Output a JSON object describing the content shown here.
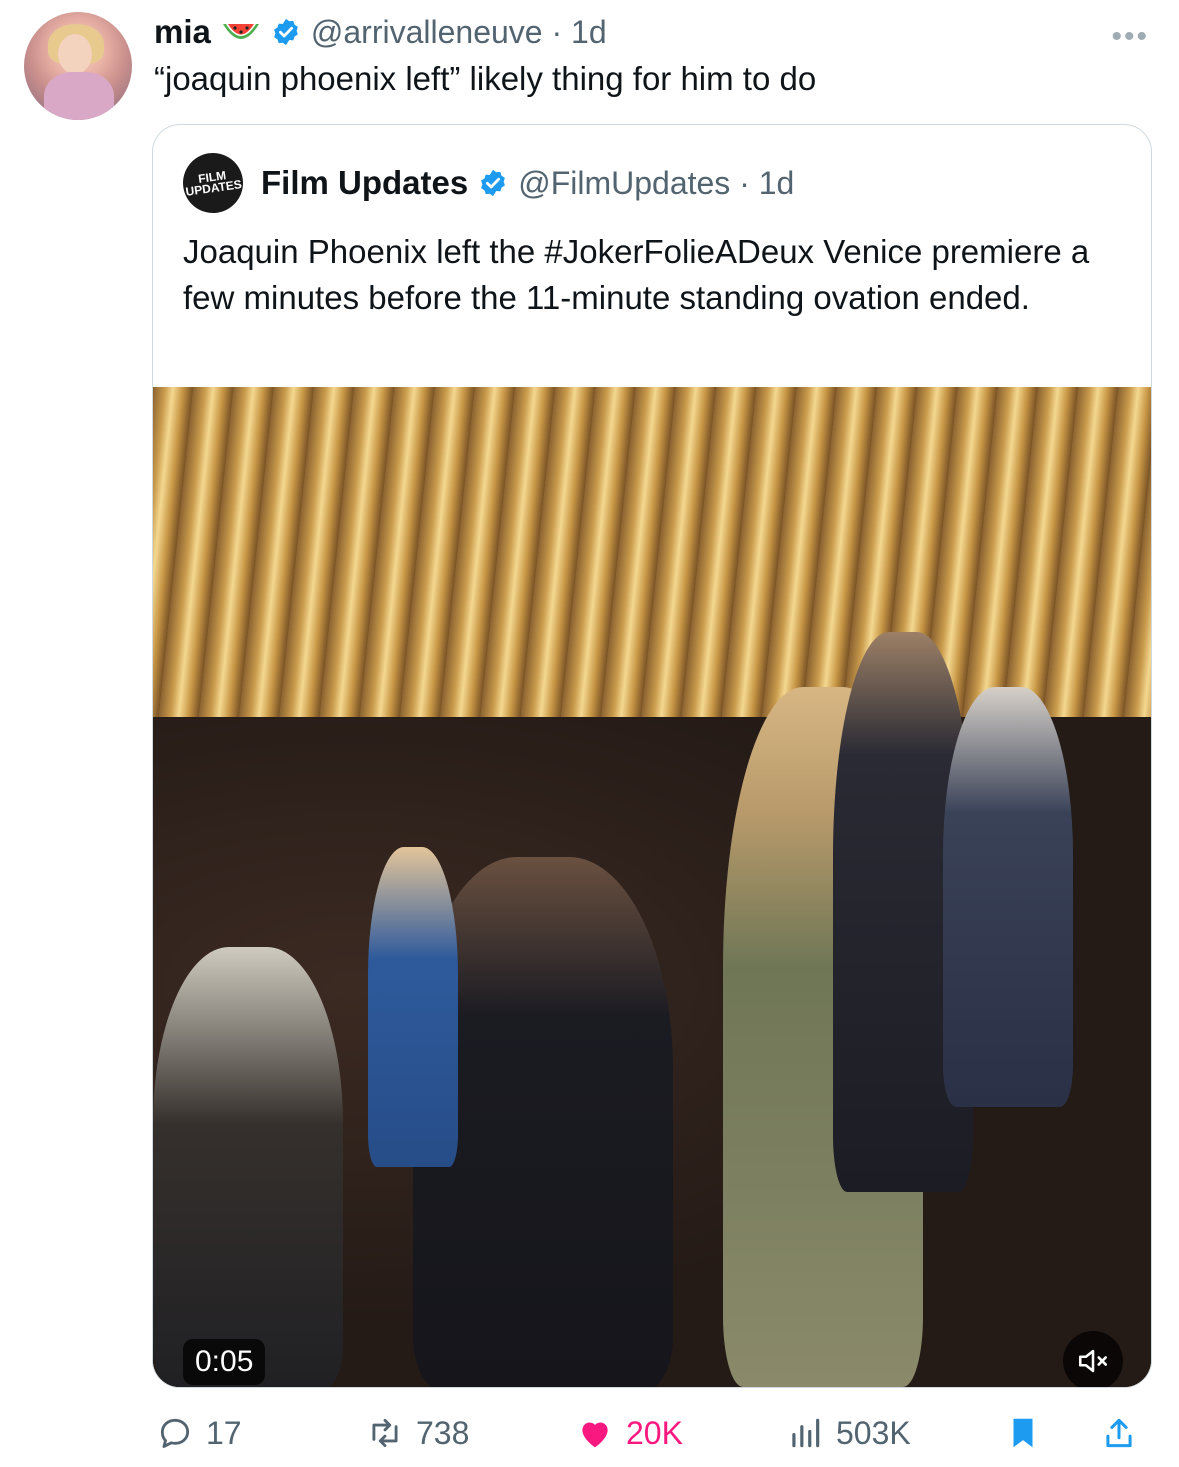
{
  "tweet": {
    "author_name": "mia",
    "handle_time": "@arrivalleneuve · 1d",
    "text": "“joaquin phoenix left” likely thing for him to do",
    "more_label": "•••"
  },
  "quoted": {
    "author_name": "Film Updates",
    "avatar_text": "FILM UPDATES",
    "handle_time": "@FilmUpdates · 1d",
    "text": "Joaquin Phoenix left the #JokerFolieADeux  Venice premiere a few minutes before the 11-minute standing ovation ended.",
    "video_time": "0:05"
  },
  "actions": {
    "replies": "17",
    "reposts": "738",
    "likes": "20K",
    "views": "503K"
  },
  "colors": {
    "verified": "#1d9bf0",
    "like": "#f91880",
    "bookmark": "#1d9bf0",
    "muted_text": "#536471"
  }
}
